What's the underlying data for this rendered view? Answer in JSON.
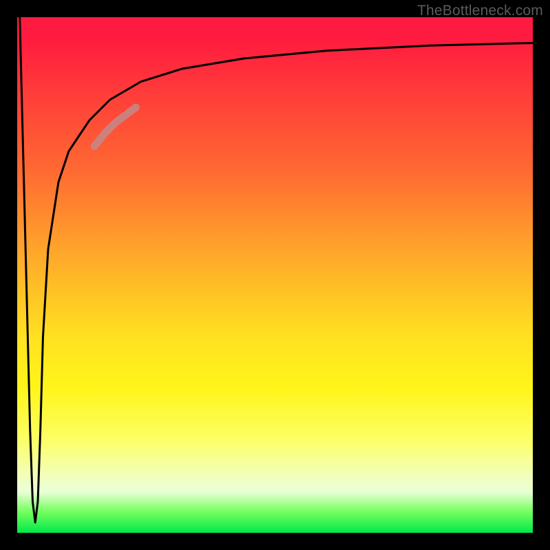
{
  "watermark": "TheBottleneck.com",
  "chart_data": {
    "type": "line",
    "title": "",
    "xlabel": "",
    "ylabel": "",
    "xlim": [
      0,
      100
    ],
    "ylim": [
      0,
      100
    ],
    "grid": false,
    "legend": false,
    "background_gradient": {
      "direction": "vertical",
      "stops": [
        {
          "pos": 0.0,
          "color": "#ff1a3f"
        },
        {
          "pos": 0.3,
          "color": "#ff6a32"
        },
        {
          "pos": 0.62,
          "color": "#ffe120"
        },
        {
          "pos": 0.88,
          "color": "#f4ffb0"
        },
        {
          "pos": 1.0,
          "color": "#00e84a"
        }
      ]
    },
    "series": [
      {
        "name": "main-curve",
        "color": "#000000",
        "stroke_width": 3,
        "x": [
          0.5,
          1.5,
          2.5,
          3.0,
          3.5,
          4.0,
          4.5,
          5.0,
          6.0,
          8.0,
          10.0,
          14.0,
          18.0,
          24.0,
          32.0,
          44.0,
          60.0,
          80.0,
          100.0
        ],
        "y": [
          100.0,
          60.0,
          20.0,
          6.0,
          2.0,
          6.0,
          20.0,
          38.0,
          55.0,
          68.0,
          74.0,
          80.0,
          84.0,
          87.5,
          90.0,
          92.0,
          93.5,
          94.5,
          95.0
        ]
      },
      {
        "name": "highlight-segment",
        "color": "#c38a88",
        "stroke_width": 11,
        "opacity": 0.85,
        "x": [
          15.0,
          17.0,
          19.0,
          21.0,
          23.0
        ],
        "y": [
          75.0,
          77.5,
          79.5,
          81.0,
          82.5
        ]
      }
    ]
  }
}
